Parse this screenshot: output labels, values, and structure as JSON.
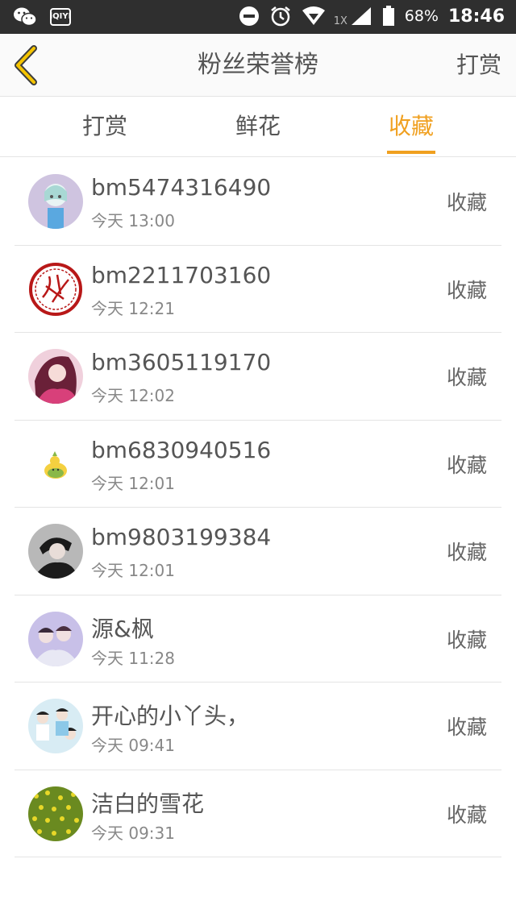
{
  "status_bar": {
    "battery": "68%",
    "time": "18:46",
    "network_badge": "1X",
    "icons": [
      "wechat-icon",
      "iqiyi-icon",
      "do-not-disturb-icon",
      "alarm-icon",
      "wifi-icon",
      "signal-icon",
      "battery-icon"
    ]
  },
  "header": {
    "title": "粉丝荣誉榜",
    "action_label": "打赏",
    "back_icon": "chevron-left-icon",
    "accent_color": "#f0a020"
  },
  "tabs": [
    {
      "label": "打赏",
      "active": false
    },
    {
      "label": "鲜花",
      "active": false
    },
    {
      "label": "收藏",
      "active": true
    }
  ],
  "fans": [
    {
      "name": "bm5474316490",
      "time": "今天 13:00",
      "action": "收藏"
    },
    {
      "name": "bm2211703160",
      "time": "今天 12:21",
      "action": "收藏"
    },
    {
      "name": "bm3605119170",
      "time": "今天 12:02",
      "action": "收藏"
    },
    {
      "name": "bm6830940516",
      "time": "今天 12:01",
      "action": "收藏"
    },
    {
      "name": "bm9803199384",
      "time": "今天 12:01",
      "action": "收藏"
    },
    {
      "name": "源&枫",
      "time": "今天 11:28",
      "action": "收藏"
    },
    {
      "name": "开心的小丫头，",
      "time": "今天 09:41",
      "action": "收藏"
    },
    {
      "name": "洁白的雪花",
      "time": "今天 09:31",
      "action": "收藏"
    }
  ]
}
